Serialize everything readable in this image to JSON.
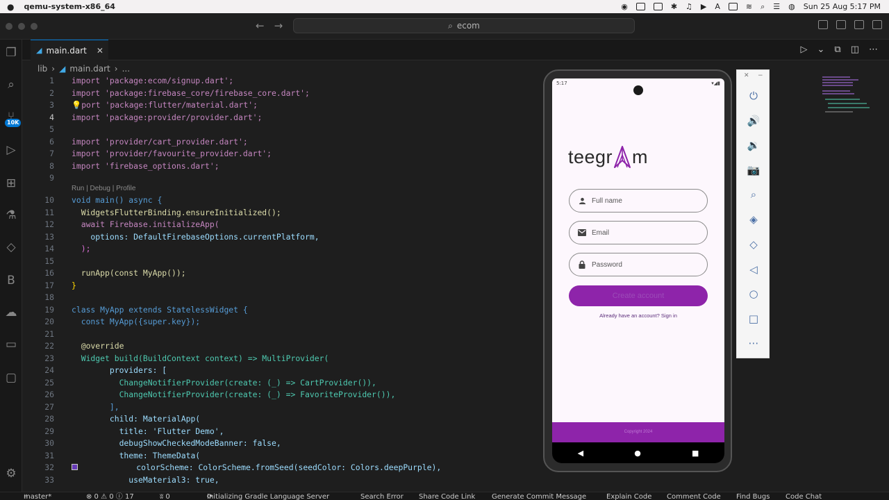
{
  "menubar": {
    "app_name": "qemu-system-x86_64",
    "clock": "Sun 25 Aug  5:17 PM"
  },
  "titlebar": {
    "search_text": "ecom"
  },
  "activity": {
    "badge": "10K"
  },
  "editor": {
    "tab_label": "main.dart",
    "breadcrumb": {
      "folder": "lib",
      "file": "main.dart",
      "ellipsis": "..."
    },
    "codelens": "Run | Debug | Profile",
    "lines": {
      "1": "import 'package:ecom/signup.dart';",
      "2": "import 'package:firebase_core/firebase_core.dart';",
      "3": "port 'package:flutter/material.dart';",
      "4": "import 'package:provider/provider.dart';",
      "6": "import 'provider/cart_provider.dart';",
      "7": "import 'provider/favourite_provider.dart';",
      "8": "import 'firebase_options.dart';",
      "10": "void main() async {",
      "11": "  WidgetsFlutterBinding.ensureInitialized();",
      "12": "  await Firebase.initializeApp(",
      "13": "    options: DefaultFirebaseOptions.currentPlatform,",
      "14": "  );",
      "16": "  runApp(const MyApp());",
      "17": "}",
      "19": "class MyApp extends StatelessWidget {",
      "20": "  const MyApp({super.key});",
      "22": "  @override",
      "23": "  Widget build(BuildContext context) => MultiProvider(",
      "24": "        providers: [",
      "25": "          ChangeNotifierProvider(create: (_) => CartProvider()),",
      "26": "          ChangeNotifierProvider(create: (_) => FavoriteProvider()),",
      "27": "        ],",
      "28": "        child: MaterialApp(",
      "29": "          title: 'Flutter Demo',",
      "30": "          debugShowCheckedModeBanner: false,",
      "31": "          theme: ThemeData(",
      "32": "            colorScheme: ColorScheme.fromSeed(seedColor: Colors.deepPurple),",
      "33": "            useMaterial3: true,"
    },
    "line_numbers": [
      "1",
      "2",
      "3",
      "4",
      "5",
      "6",
      "7",
      "8",
      "9",
      "10",
      "11",
      "12",
      "13",
      "14",
      "15",
      "16",
      "17",
      "18",
      "19",
      "20",
      "21",
      "22",
      "23",
      "24",
      "25",
      "26",
      "27",
      "28",
      "29",
      "30",
      "31",
      "32",
      "33"
    ]
  },
  "emulator": {
    "status_time": "5:17",
    "logo_left": "teegr",
    "logo_right": "m",
    "full_name_placeholder": "Full name",
    "email_placeholder": "Email",
    "password_placeholder": "Password",
    "create_button": "Create account",
    "signin_link": "Already have an account? Sign in",
    "footer": "Copyright 2024"
  },
  "statusbar": {
    "branch": "master*",
    "problems": "⊗ 0  ⚠ 0  ⓘ 17",
    "ports": "ʬ 0",
    "gradle": "Initializing Gradle Language Server",
    "search_error": "Search Error",
    "share_code": "Share Code Link",
    "commit_msg": "Generate Commit Message",
    "explain": "Explain Code",
    "comment": "Comment Code",
    "find_bugs": "Find Bugs",
    "code_chat": "Code Chat"
  },
  "colors": {
    "accent": "#0078d4",
    "app_purple": "#8e24aa"
  }
}
